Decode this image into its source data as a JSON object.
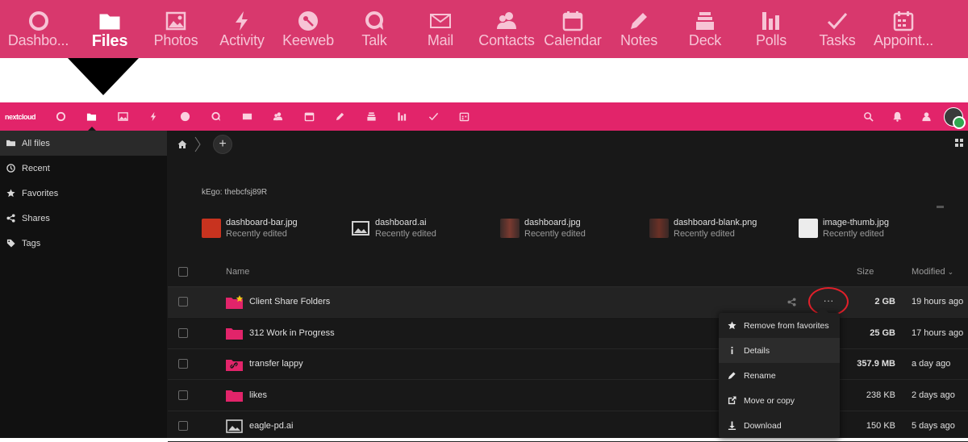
{
  "big_app_bar": {
    "apps": [
      {
        "label": "Dashbo...",
        "icon": "dashboard-icon"
      },
      {
        "label": "Files",
        "icon": "folder-icon",
        "active": true
      },
      {
        "label": "Photos",
        "icon": "image-icon"
      },
      {
        "label": "Activity",
        "icon": "lightning-icon"
      },
      {
        "label": "Keeweb",
        "icon": "key-icon"
      },
      {
        "label": "Talk",
        "icon": "talk-bubble-icon"
      },
      {
        "label": "Mail",
        "icon": "mail-icon"
      },
      {
        "label": "Contacts",
        "icon": "contacts-icon"
      },
      {
        "label": "Calendar",
        "icon": "calendar-icon"
      },
      {
        "label": "Notes",
        "icon": "pencil-icon"
      },
      {
        "label": "Deck",
        "icon": "deck-icon"
      },
      {
        "label": "Polls",
        "icon": "polls-icon"
      },
      {
        "label": "Tasks",
        "icon": "checkmark-icon"
      },
      {
        "label": "Appoint...",
        "icon": "appointments-icon"
      }
    ]
  },
  "header": {
    "logo_text": "nextcloud"
  },
  "sidebar": {
    "items": [
      {
        "label": "All files",
        "icon": "folder-icon",
        "active": true
      },
      {
        "label": "Recent",
        "icon": "clock-icon"
      },
      {
        "label": "Favorites",
        "icon": "star-icon"
      },
      {
        "label": "Shares",
        "icon": "share-icon"
      },
      {
        "label": "Tags",
        "icon": "tag-icon"
      }
    ]
  },
  "main": {
    "add_label": "+",
    "note": "kEgo: thebcfsj89R",
    "recent": [
      {
        "name": "dashboard-bar.jpg",
        "status": "Recently edited",
        "thumb": "#c8331f"
      },
      {
        "name": "dashboard.ai",
        "status": "Recently edited",
        "thumb": "#2a2a2a"
      },
      {
        "name": "dashboard.jpg",
        "status": "Recently edited",
        "thumb": "#5a2a24"
      },
      {
        "name": "dashboard-blank.png",
        "status": "Recently edited",
        "thumb": "#4a2622"
      },
      {
        "name": "image-thumb.jpg",
        "status": "Recently edited",
        "thumb": "#e8e8e8"
      }
    ],
    "table": {
      "headers": {
        "name": "Name",
        "size": "Size",
        "modified": "Modified"
      },
      "sort_indicator": "⌄",
      "rows": [
        {
          "name": "Client Share Folders",
          "size": "2 GB",
          "modified": "19 hours ago",
          "type": "folder",
          "favorite": true
        },
        {
          "name": "312 Work in Progress",
          "size": "25 GB",
          "modified": "17 hours ago",
          "type": "folder"
        },
        {
          "name": "transfer lappy",
          "size": "357.9 MB",
          "modified": "a day ago",
          "type": "link-folder"
        },
        {
          "name": "likes",
          "size": "238 KB",
          "modified": "2 days ago",
          "type": "folder"
        },
        {
          "name": "eagle-pd.ai",
          "size": "150 KB",
          "modified": "5 days ago",
          "type": "image"
        }
      ]
    },
    "more_label": "···"
  },
  "context_menu": {
    "items": [
      {
        "label": "Remove from favorites",
        "icon": "star-icon"
      },
      {
        "label": "Details",
        "icon": "info-icon",
        "highlighted": true
      },
      {
        "label": "Rename",
        "icon": "pencil-icon"
      },
      {
        "label": "Move or copy",
        "icon": "external-link-icon"
      },
      {
        "label": "Download",
        "icon": "download-icon"
      }
    ]
  },
  "colors": {
    "brand": "#e2246a",
    "brand_zoomed": "#d8386d",
    "folder": "#e2246a",
    "highlight_circle": "#e0202a"
  }
}
